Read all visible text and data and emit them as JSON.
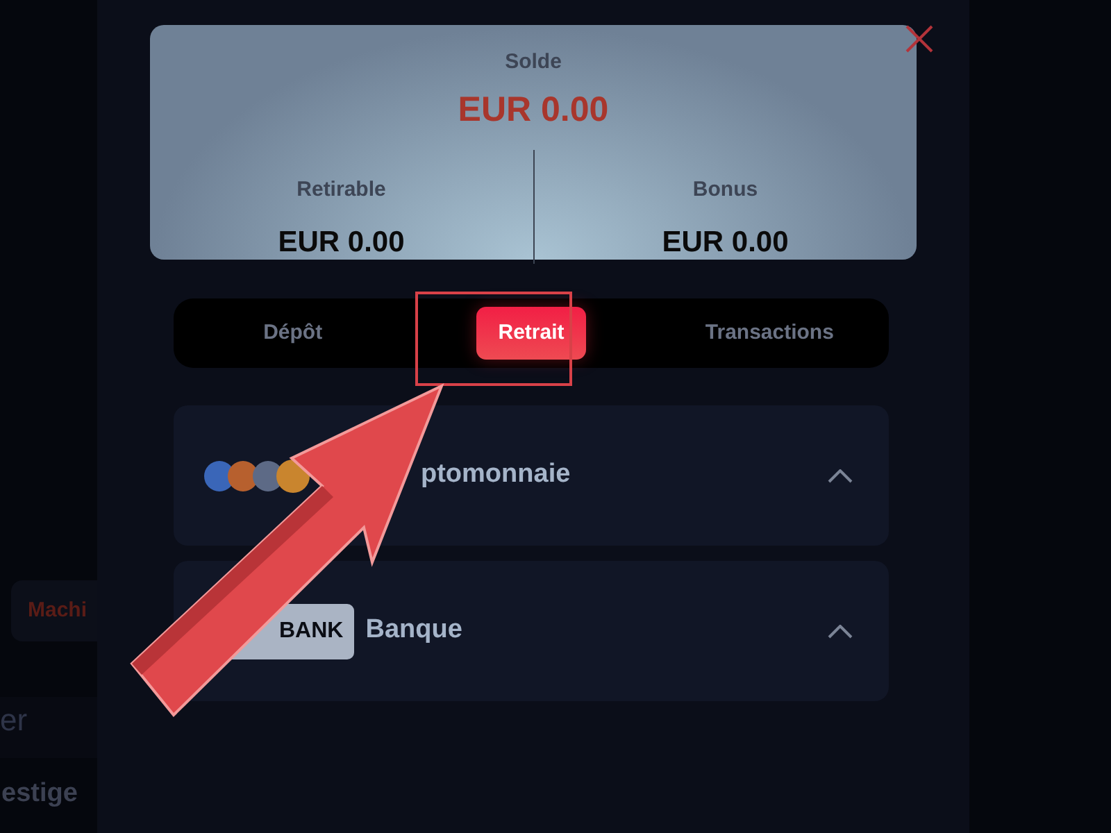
{
  "background": {
    "button": "Machi",
    "field": "er",
    "heading": "estige"
  },
  "balance": {
    "label": "Solde",
    "amount": "EUR 0.00",
    "columns": [
      {
        "label": "Retirable",
        "amount": "EUR 0.00"
      },
      {
        "label": "Bonus",
        "amount": "EUR 0.00"
      }
    ]
  },
  "tabs": [
    {
      "label": "Dépôt",
      "selected": false
    },
    {
      "label": "Retrait",
      "selected": true
    },
    {
      "label": "Transactions",
      "selected": false
    }
  ],
  "methods": [
    {
      "kind": "crypto",
      "label": "ptomonnaie"
    },
    {
      "kind": "bank",
      "badge": "BANK",
      "label": "Banque"
    }
  ]
}
